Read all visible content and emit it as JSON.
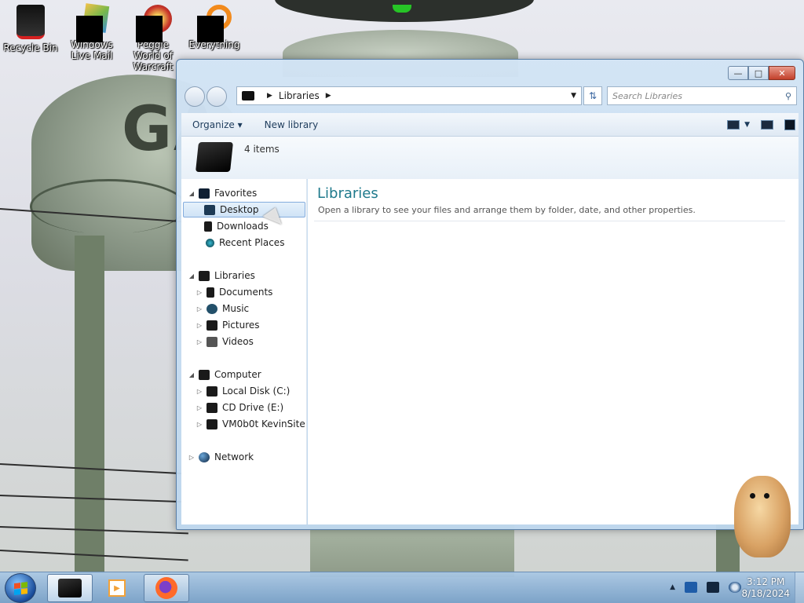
{
  "desktop": {
    "icons": [
      {
        "label": "Recycle Bin",
        "icon": "recycle-bin-icon"
      },
      {
        "label": "Windows Live Mail",
        "icon": "windows-live-mail-icon"
      },
      {
        "label": "Peggle World of Warcraft",
        "icon": "peggle-icon"
      },
      {
        "label": "Everything",
        "icon": "everything-search-icon"
      }
    ],
    "wall_text": "GA"
  },
  "window": {
    "address": {
      "segments": [
        "Libraries"
      ]
    },
    "search_placeholder": "Search Libraries",
    "command_bar": {
      "organize": "Organize",
      "new_library": "New library"
    },
    "info": {
      "item_count": "4 items"
    },
    "content": {
      "title": "Libraries",
      "subtitle": "Open a library to see your files and arrange them by folder, date, and other properties."
    },
    "nav": {
      "favorites": {
        "label": "Favorites",
        "items": [
          "Desktop",
          "Downloads",
          "Recent Places"
        ],
        "selected": "Desktop"
      },
      "libraries": {
        "label": "Libraries",
        "items": [
          "Documents",
          "Music",
          "Pictures",
          "Videos"
        ]
      },
      "computer": {
        "label": "Computer",
        "items": [
          "Local Disk (C:)",
          "CD Drive (E:)",
          "VM0b0t KevinSite"
        ]
      },
      "network": {
        "label": "Network"
      }
    }
  },
  "taskbar": {
    "pinned": [
      "windows-explorer-icon",
      "media-player-icon",
      "firefox-icon"
    ],
    "tray_icons": [
      "show-hidden-icons-arrow",
      "network-icon",
      "display-icon",
      "volume-icon"
    ],
    "clock": {
      "time": "3:12 PM",
      "date": "8/18/2024"
    }
  }
}
